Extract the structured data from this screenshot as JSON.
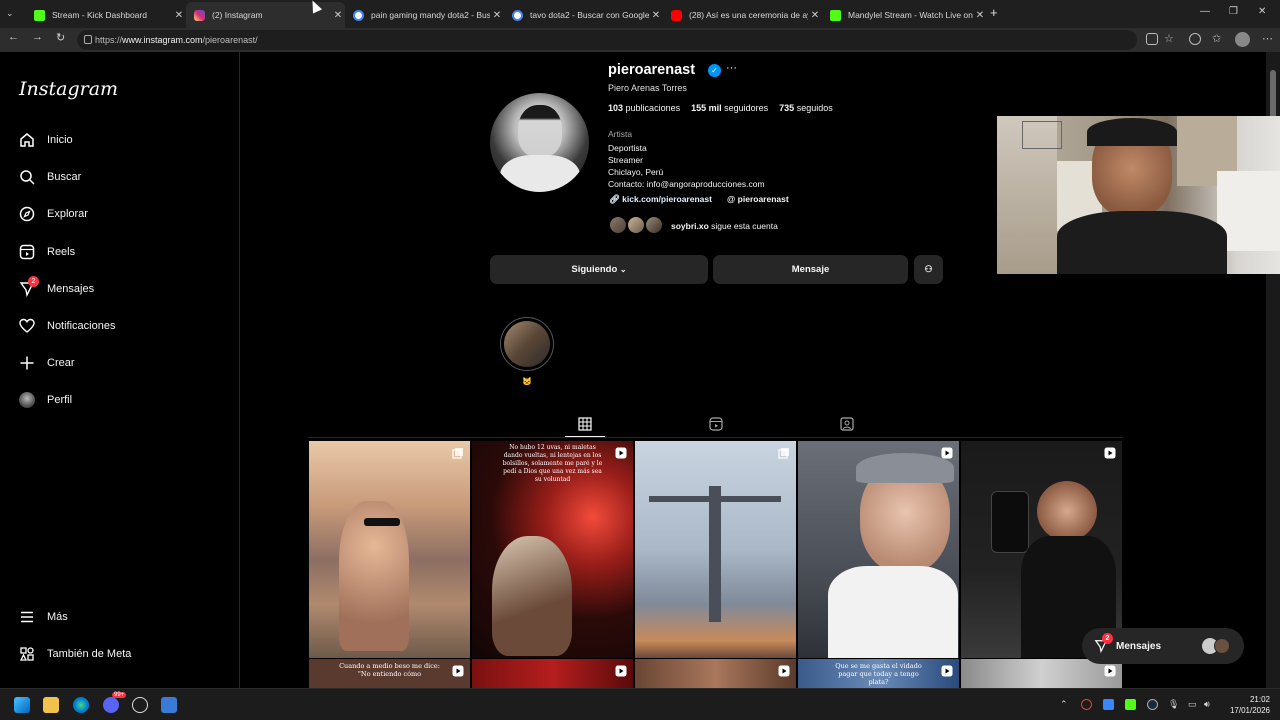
{
  "browser": {
    "tabs": [
      {
        "title": "Stream - Kick Dashboard",
        "favicon_color": "#53fc18",
        "active": false
      },
      {
        "title": "(2) Instagram",
        "favicon_color": "#d62976",
        "active": true
      },
      {
        "title": "pain gaming mandy dota2 - Busca",
        "favicon_color": "#4285f4",
        "active": false
      },
      {
        "title": "tavo dota2 - Buscar con Google",
        "favicon_color": "#4285f4",
        "active": false
      },
      {
        "title": "(28) Así es una ceremonia de ayah",
        "favicon_color": "#ff0000",
        "active": false
      },
      {
        "title": "Mandylel Stream - Watch Live on",
        "favicon_color": "#53fc18",
        "active": false
      }
    ],
    "url_scheme": "https://",
    "url_host": "www.instagram.com",
    "url_path": "/pieroarenast/"
  },
  "sidebar": {
    "logo": "Instagram",
    "items": [
      {
        "label": "Inicio",
        "icon": "home-icon"
      },
      {
        "label": "Buscar",
        "icon": "search-icon"
      },
      {
        "label": "Explorar",
        "icon": "compass-icon"
      },
      {
        "label": "Reels",
        "icon": "reels-icon"
      },
      {
        "label": "Mensajes",
        "icon": "messenger-icon",
        "badge": "2"
      },
      {
        "label": "Notificaciones",
        "icon": "heart-icon"
      },
      {
        "label": "Crear",
        "icon": "plus-icon"
      },
      {
        "label": "Perfil",
        "icon": "avatar-icon"
      }
    ],
    "more": "Más",
    "meta": "También de Meta"
  },
  "profile": {
    "username": "pieroarenast",
    "full_name": "Piero Arenas Torres",
    "stats": {
      "posts_count": "103",
      "posts_label": "publicaciones",
      "followers_count": "155 mil",
      "followers_label": "seguidores",
      "following_count": "735",
      "following_label": "seguidos"
    },
    "category": "Artista",
    "bio": [
      "Deportista",
      "Streamer",
      "Chiclayo, Perú",
      "Contacto: info@angoraproducciones.com"
    ],
    "link": "kick.com/pieroarenast",
    "threads": "pieroarenast",
    "followed_by_user": "soybri.xo",
    "followed_by_text": "sigue esta cuenta",
    "following_button": "Siguiendo",
    "message_button": "Mensaje",
    "highlight_label": "🐱"
  },
  "grid": {
    "captions": {
      "post2": "No hubo 12 uvas, ni maletas dando vueltas, ni lentejas en los bolsillos, solamente me paré y le pedí a Dios que una vez más sea su voluntad",
      "post6": "Cuando a medio beso me dice: \"No entiendo cómo",
      "post9": "Que se me gasta el vidado pagar que today a tengo plata?"
    }
  },
  "messages_pill": {
    "label": "Mensajes",
    "badge": "2"
  },
  "taskbar": {
    "time": "21:02",
    "date": "17/01/2026",
    "discord_badge": "99+"
  }
}
